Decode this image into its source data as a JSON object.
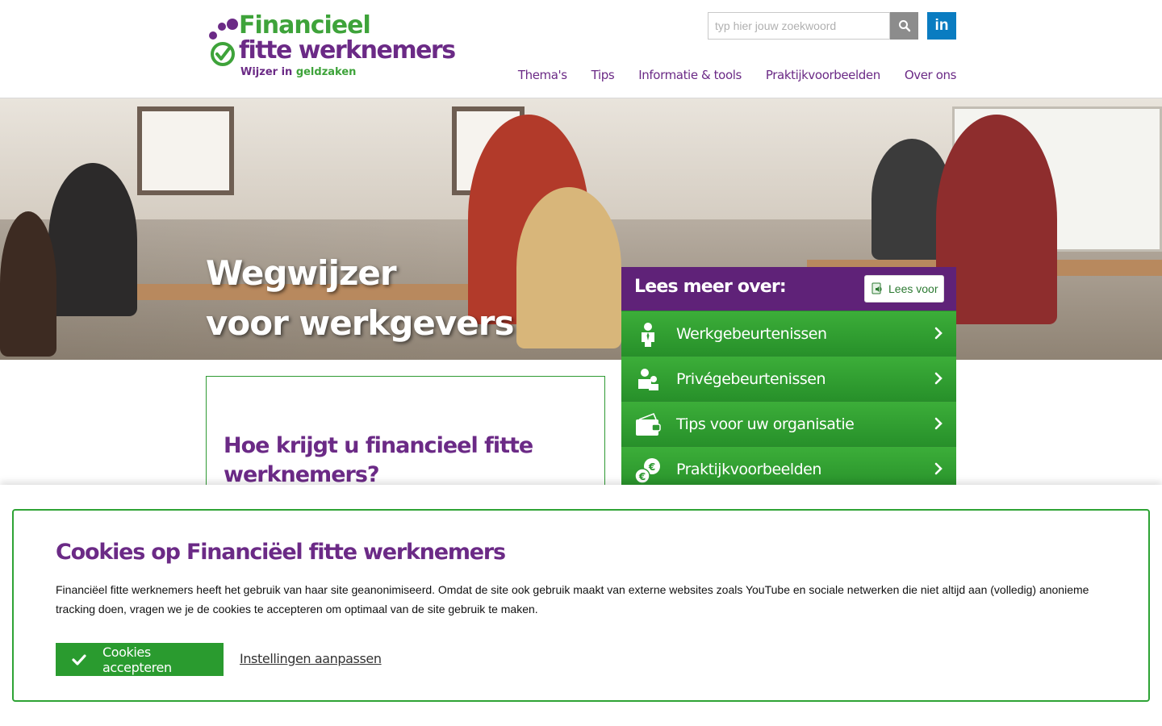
{
  "brand": {
    "logo_line1": "Financieel",
    "logo_line2": "fitte werknemers",
    "tagline_part1": "Wijzer in ",
    "tagline_part2": "geldzaken",
    "colors": {
      "purple": "#6b2a86",
      "green": "#3ea33a",
      "linkedin": "#0a7cc1"
    }
  },
  "search": {
    "placeholder": "typ hier jouw zoekwoord",
    "button_icon": "search-icon"
  },
  "social": {
    "linkedin_label": "in"
  },
  "nav": {
    "items": [
      {
        "label": "Thema's"
      },
      {
        "label": "Tips"
      },
      {
        "label": "Informatie & tools"
      },
      {
        "label": "Praktijkvoorbeelden"
      },
      {
        "label": "Over ons"
      }
    ]
  },
  "hero": {
    "title_line1": "Wegwijzer",
    "title_line2": "voor werkgevers"
  },
  "panel": {
    "title": "Lees meer over:",
    "read_aloud_label": "Lees voor",
    "items": [
      {
        "label": "Werkgebeurtenissen",
        "icon": "employee-icon"
      },
      {
        "label": "Privégebeurtenissen",
        "icon": "family-icon"
      },
      {
        "label": "Tips voor uw organisatie",
        "icon": "wallet-icon"
      },
      {
        "label": "Praktijkvoorbeelden",
        "icon": "coins-icon"
      }
    ]
  },
  "content": {
    "title": "Hoe krijgt u financieel fitte werknemers?"
  },
  "cookie": {
    "title": "Cookies op Financiëel fitte werknemers",
    "text": "Financiëel fitte werknemers heeft het gebruik van haar site geanonimiseerd. Omdat de site ook gebruik maakt van externe websites zoals YouTube en sociale netwerken die niet altijd aan (volledig) anonieme tracking doen, vragen we je de cookies te accepteren om optimaal van de site gebruik te maken.",
    "accept_label": "Cookies accepteren",
    "settings_label": "Instellingen aanpassen"
  }
}
